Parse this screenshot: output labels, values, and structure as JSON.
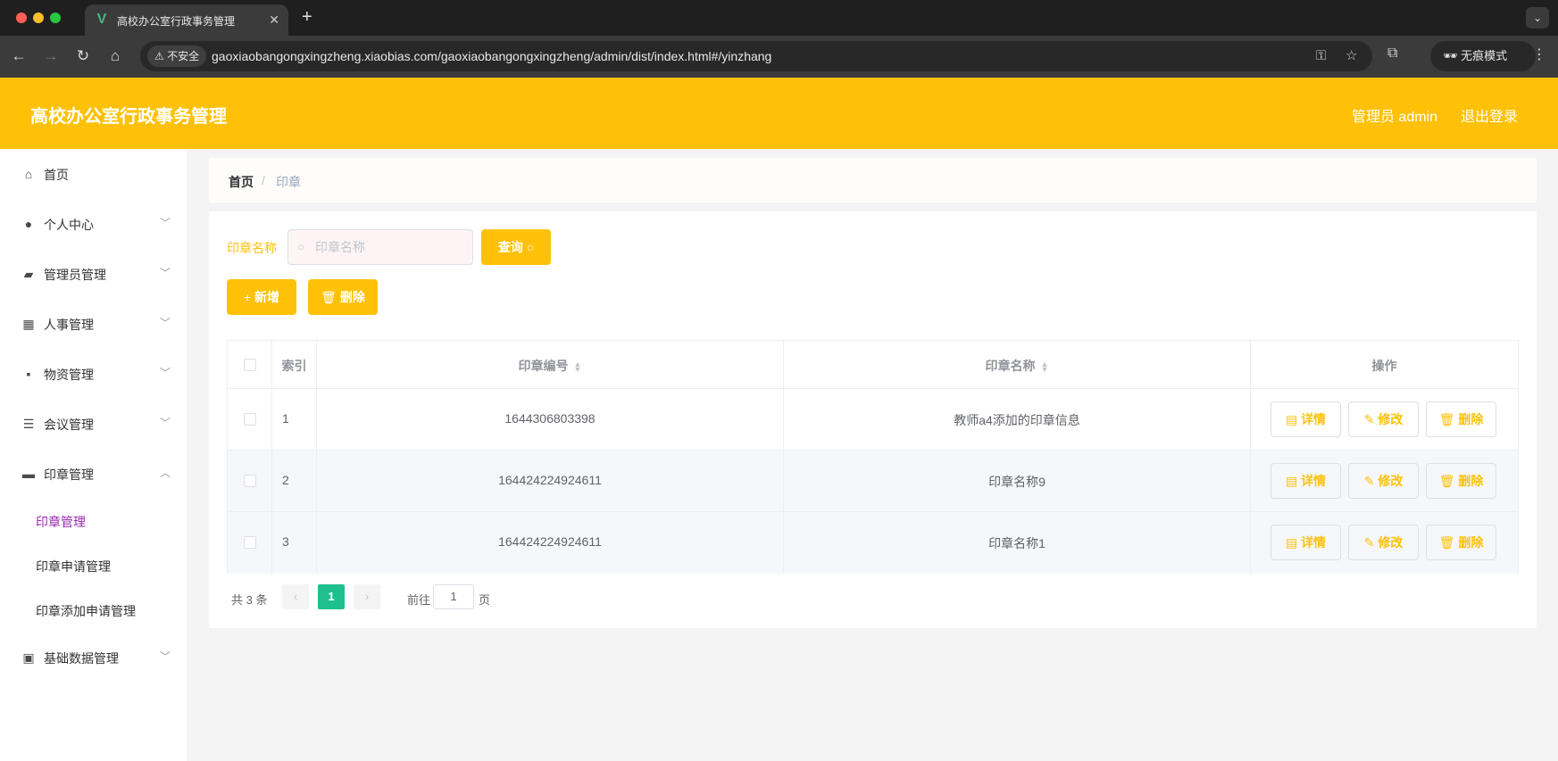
{
  "browser": {
    "tab_title": "高校办公室行政事务管理",
    "insecure_label": "不安全",
    "url": "gaoxiaobangongxingzheng.xiaobias.com/gaoxiaobangongxingzheng/admin/dist/index.html#/yinzhang",
    "incognito_label": "无痕模式"
  },
  "header": {
    "title": "高校办公室行政事务管理",
    "user_label": "管理员 admin",
    "logout_label": "退出登录",
    "accent_color": "#ffc107"
  },
  "sidebar": {
    "items": [
      {
        "label": "首页",
        "icon": "home-icon"
      },
      {
        "label": "个人中心",
        "icon": "user-icon"
      },
      {
        "label": "管理员管理",
        "icon": "ticket-icon"
      },
      {
        "label": "人事管理",
        "icon": "grid-icon"
      },
      {
        "label": "物资管理",
        "icon": "message-icon"
      },
      {
        "label": "会议管理",
        "icon": "list-icon"
      },
      {
        "label": "印章管理",
        "icon": "printer-icon"
      },
      {
        "label": "基础数据管理",
        "icon": "clipboard-icon"
      }
    ],
    "sub_items": [
      {
        "label": "印章管理",
        "active": true
      },
      {
        "label": "印章申请管理",
        "active": false
      },
      {
        "label": "印章添加申请管理",
        "active": false
      }
    ],
    "active_color": "#9c27b0"
  },
  "breadcrumb": {
    "home": "首页",
    "separator": "/",
    "current": "印章"
  },
  "search": {
    "label": "印章名称",
    "placeholder": "印章名称",
    "query_label": "查询"
  },
  "toolbar": {
    "add_label": "新增",
    "delete_label": "删除"
  },
  "table": {
    "columns": [
      "索引",
      "印章编号",
      "印章名称",
      "操作"
    ],
    "rows": [
      {
        "index": "1",
        "code": "1644306803398",
        "name": "教师a4添加的印章信息"
      },
      {
        "index": "2",
        "code": "164424224924611",
        "name": "印章名称9"
      },
      {
        "index": "3",
        "code": "164424224924611",
        "name": "印章名称1"
      }
    ],
    "actions": {
      "detail": "详情",
      "edit": "修改",
      "delete": "删除"
    }
  },
  "pagination": {
    "total_text": "共 3 条",
    "current_page": "1",
    "goto_label": "前往",
    "goto_value": "1",
    "page_suffix": "页",
    "active_color": "#1fc08e"
  }
}
